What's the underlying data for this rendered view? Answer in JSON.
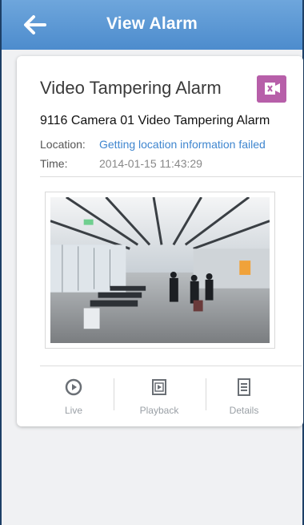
{
  "header": {
    "title": "View Alarm",
    "back_icon": "arrow-left-icon"
  },
  "alarm": {
    "title": "Video Tampering Alarm",
    "type_icon": "video-tampering-icon",
    "type_icon_color": "#b75fa9",
    "subtitle": "9116 Camera 01 Video Tampering Alarm",
    "location_label": "Location:",
    "location_value": "Getting location information failed",
    "time_label": "Time:",
    "time_value": "2014-01-15 11:43:29"
  },
  "actions": [
    {
      "label": "Live",
      "icon": "play-circle-icon"
    },
    {
      "label": "Playback",
      "icon": "film-playback-icon"
    },
    {
      "label": "Details",
      "icon": "document-icon"
    }
  ],
  "colors": {
    "header": "#5b97d4",
    "link": "#3f86cf"
  }
}
